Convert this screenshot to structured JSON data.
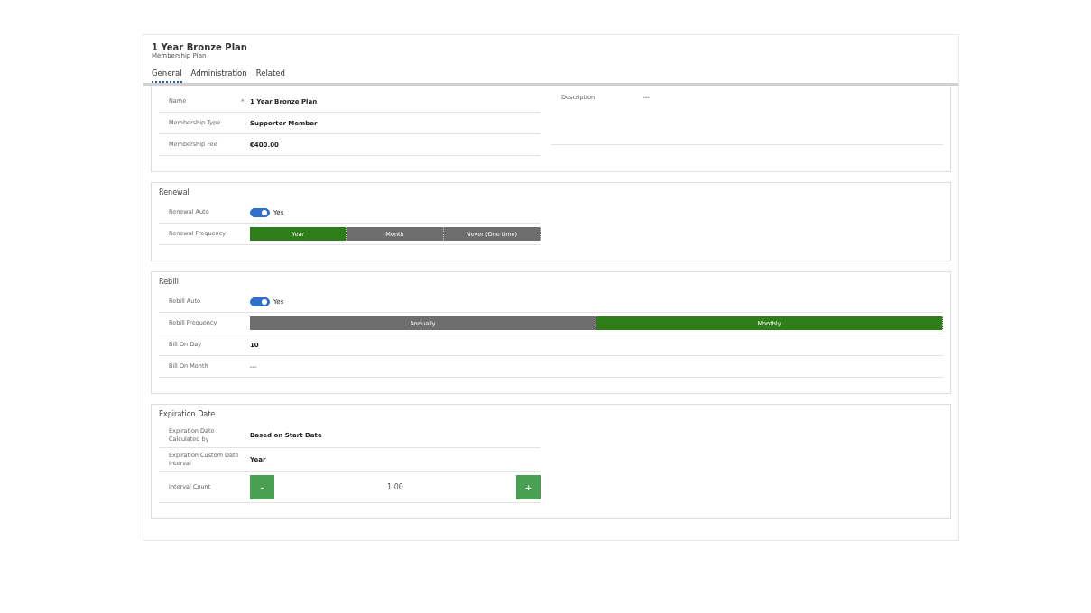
{
  "header": {
    "title": "1 Year Bronze Plan",
    "subtitle": "Membership Plan"
  },
  "tabs": [
    {
      "label": "General",
      "selected": true
    },
    {
      "label": "Administration",
      "selected": false
    },
    {
      "label": "Related",
      "selected": false
    }
  ],
  "general": {
    "fields": [
      {
        "kind": "text",
        "label": "Name",
        "marker": "*",
        "value": "1 Year Bronze Plan"
      },
      {
        "kind": "text",
        "label": "Membership Type",
        "value": "Supporter Member"
      },
      {
        "kind": "text",
        "label": "Membership Fee",
        "value": "€400.00"
      }
    ],
    "description": {
      "label": "Description",
      "value": "---"
    }
  },
  "sections": [
    {
      "title": "Renewal",
      "wide": false,
      "fields": [
        {
          "kind": "toggle",
          "label": "Renewal Auto",
          "on": true,
          "value": "Yes"
        },
        {
          "kind": "segmented",
          "label": "Renewal Frequency",
          "options": [
            {
              "label": "Year",
              "selected": true
            },
            {
              "label": "Month",
              "selected": false
            },
            {
              "label": "Never (One time)",
              "selected": false
            }
          ]
        }
      ]
    },
    {
      "title": "Rebill",
      "wide": true,
      "fields": [
        {
          "kind": "toggle",
          "label": "Rebill Auto",
          "on": true,
          "value": "Yes"
        },
        {
          "kind": "segmented",
          "label": "Rebill Frequency",
          "options": [
            {
              "label": "Annually",
              "selected": false
            },
            {
              "label": "Monthly",
              "selected": true
            }
          ]
        },
        {
          "kind": "text",
          "label": "Bill On Day",
          "value": "10"
        },
        {
          "kind": "text",
          "label": "Bill On Month",
          "value": "---",
          "empty": true
        }
      ]
    },
    {
      "title": "Expiration Date",
      "wide": false,
      "fields": [
        {
          "kind": "text",
          "label": "Expiration Date Calculated by",
          "value": "Based on Start Date"
        },
        {
          "kind": "text",
          "label": "Expiration Custom Date Interval",
          "value": "Year"
        },
        {
          "kind": "stepper",
          "label": "Interval Count",
          "value": "1.00",
          "minus": "-",
          "plus": "+"
        }
      ]
    }
  ]
}
